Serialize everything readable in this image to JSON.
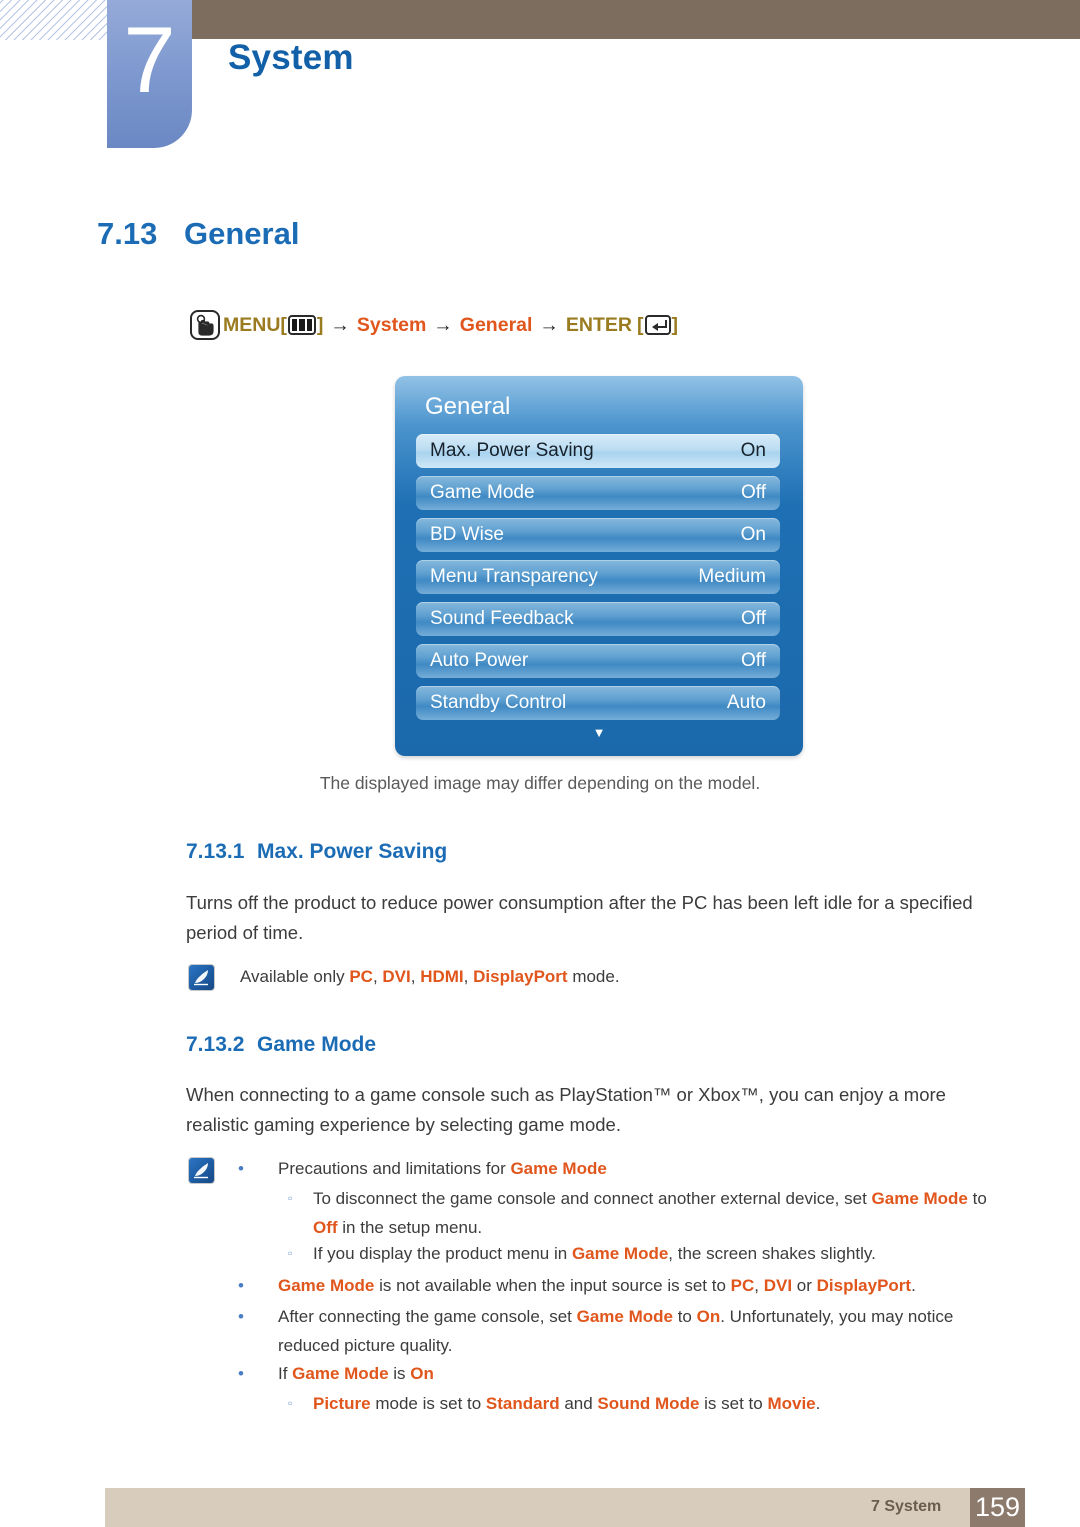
{
  "chapter": {
    "number": "7",
    "title": "System"
  },
  "section": {
    "number": "7.13",
    "title": "General"
  },
  "menu_path": {
    "hand_icon": "hand-press-icon",
    "menu_label": "MENU",
    "menu_key_icon": "menu-key-icon",
    "bracket_open": "[",
    "bracket_close": "]",
    "arrow": "→",
    "step1": "System",
    "step2": "General",
    "enter_label": "ENTER",
    "enter_key_icon": "enter-key-icon"
  },
  "osd": {
    "title": "General",
    "rows": [
      {
        "label": "Max. Power Saving",
        "value": "On",
        "selected": true
      },
      {
        "label": "Game Mode",
        "value": "Off",
        "selected": false
      },
      {
        "label": "BD Wise",
        "value": "On",
        "selected": false
      },
      {
        "label": "Menu Transparency",
        "value": "Medium",
        "selected": false
      },
      {
        "label": "Sound Feedback",
        "value": "Off",
        "selected": false
      },
      {
        "label": "Auto Power",
        "value": "Off",
        "selected": false
      },
      {
        "label": "Standby Control",
        "value": "Auto",
        "selected": false
      }
    ],
    "scroll_caret": "▼",
    "caption": "The displayed image may differ depending on the model."
  },
  "subsections": [
    {
      "number": "7.13.1",
      "title": "Max. Power Saving",
      "body": "Turns off the product to reduce power consumption after the PC has been left idle for a specified period of time."
    },
    {
      "number": "7.13.2",
      "title": "Game Mode",
      "body": "When connecting to a game console such as PlayStation™ or Xbox™, you can enjoy a more realistic gaming experience by selecting game mode."
    }
  ],
  "note1": {
    "icon": "note-pen-icon",
    "text_a": "Available only ",
    "pc": "PC",
    "sep1": ", ",
    "dvi": "DVI",
    "sep2": ", ",
    "hdmi": "HDMI",
    "sep3": ", ",
    "displayport": "DisplayPort",
    "text_b": " mode."
  },
  "note2": {
    "icon": "note-pen-icon",
    "bullet": "•",
    "sub_bullet": "▫",
    "b1_pre": "Precautions and limitations for ",
    "b1_gm": "Game Mode",
    "b1s1_pre": "To disconnect the game console and connect another external device, set ",
    "b1s1_gm": "Game Mode",
    "b1s1_mid": " to ",
    "b1s1_off": "Off",
    "b1s1_post": " in the setup menu.",
    "b1s2_pre": "If you display the product menu in ",
    "b1s2_gm": "Game Mode",
    "b1s2_post": ", the screen shakes slightly.",
    "b2_gm": "Game Mode",
    "b2_mid": " is not available when the input source is set to ",
    "b2_pc": "PC",
    "b2_sep1": ", ",
    "b2_dvi": "DVI",
    "b2_or": " or ",
    "b2_dp": "DisplayPort",
    "b2_end": ".",
    "b3_pre": "After connecting the game console, set ",
    "b3_gm": "Game Mode",
    "b3_mid": " to ",
    "b3_on": "On",
    "b3_post": ". Unfortunately, you may notice reduced picture quality.",
    "b4_pre": "If ",
    "b4_gm": "Game Mode",
    "b4_mid": " is ",
    "b4_on": "On",
    "b4s1_pic": "Picture",
    "b4s1_mid1": " mode is set to ",
    "b4s1_std": "Standard",
    "b4s1_mid2": " and ",
    "b4s1_sm": "Sound Mode",
    "b4s1_mid3": " is set to ",
    "b4s1_movie": "Movie",
    "b4s1_end": "."
  },
  "footer": {
    "label": "7 System",
    "page": "159"
  },
  "colors": {
    "heading_blue": "#1b6cb5",
    "accent_orange": "#e0561c",
    "banner_brown": "#7d6d5e",
    "footer_tan": "#d8cdbc",
    "page_box": "#8c7a6d",
    "osd_blue": "#1e6fb4"
  }
}
